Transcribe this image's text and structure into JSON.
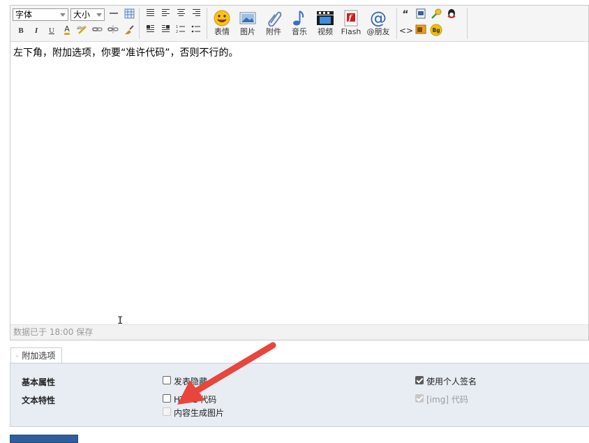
{
  "toolbar": {
    "font_select": "字体",
    "size_select": "大小",
    "row1_format_icons": [
      "horizontal-rule-icon",
      "table-icon",
      "align-justify-icon",
      "align-left-icon",
      "align-center-icon",
      "align-right-icon"
    ],
    "row2_format_icons": [
      "bold-icon",
      "italic-icon",
      "underline-icon",
      "font-color-icon",
      "spellcheck-icon",
      "link-icon",
      "unlink-icon",
      "clear-format-icon",
      "float-left-icon",
      "float-right-icon",
      "ordered-list-icon",
      "unordered-list-icon"
    ],
    "bold": "B",
    "italic": "I",
    "underline": "U",
    "font_color": "A",
    "media_buttons": [
      {
        "label": "表情",
        "icon": "smiley-icon"
      },
      {
        "label": "图片",
        "icon": "image-icon"
      },
      {
        "label": "附件",
        "icon": "paperclip-icon"
      },
      {
        "label": "音乐",
        "icon": "music-note-icon"
      },
      {
        "label": "视频",
        "icon": "video-icon"
      },
      {
        "label": "Flash",
        "icon": "flash-icon"
      },
      {
        "label": "@朋友",
        "icon": "at-icon"
      }
    ],
    "extra_icons": [
      "quote-icon",
      "word-paste-icon",
      "password-key-icon",
      "qq-icon",
      "code-icon",
      "free-frame-icon",
      "background-icon"
    ],
    "quote_glyph": "“",
    "code_glyph": "<>",
    "bg_glyph": "Bg"
  },
  "editor": {
    "content": "左下角，附加选项，你要“准许代码”，否则不行的。",
    "status": "数据已于 18:00 保存"
  },
  "options": {
    "tab_label": "附加选项",
    "row_basic": "基本属性",
    "row_text": "文本特性",
    "checkboxes": {
      "hidden": {
        "label": "发表隐藏",
        "checked": false
      },
      "html": {
        "label": "HTML 代码",
        "checked": false
      },
      "image_gen": {
        "label": "内容生成图片",
        "checked": false,
        "disabled": true
      },
      "signature": {
        "label": "使用个人签名",
        "checked": true
      },
      "img_code": {
        "label": "[img] 代码",
        "checked": true,
        "disabled": true
      }
    }
  },
  "colors": {
    "annotation_arrow": "#e8453c",
    "panel_bg": "#e8edf3",
    "submit_button": "#2f5f9a"
  }
}
